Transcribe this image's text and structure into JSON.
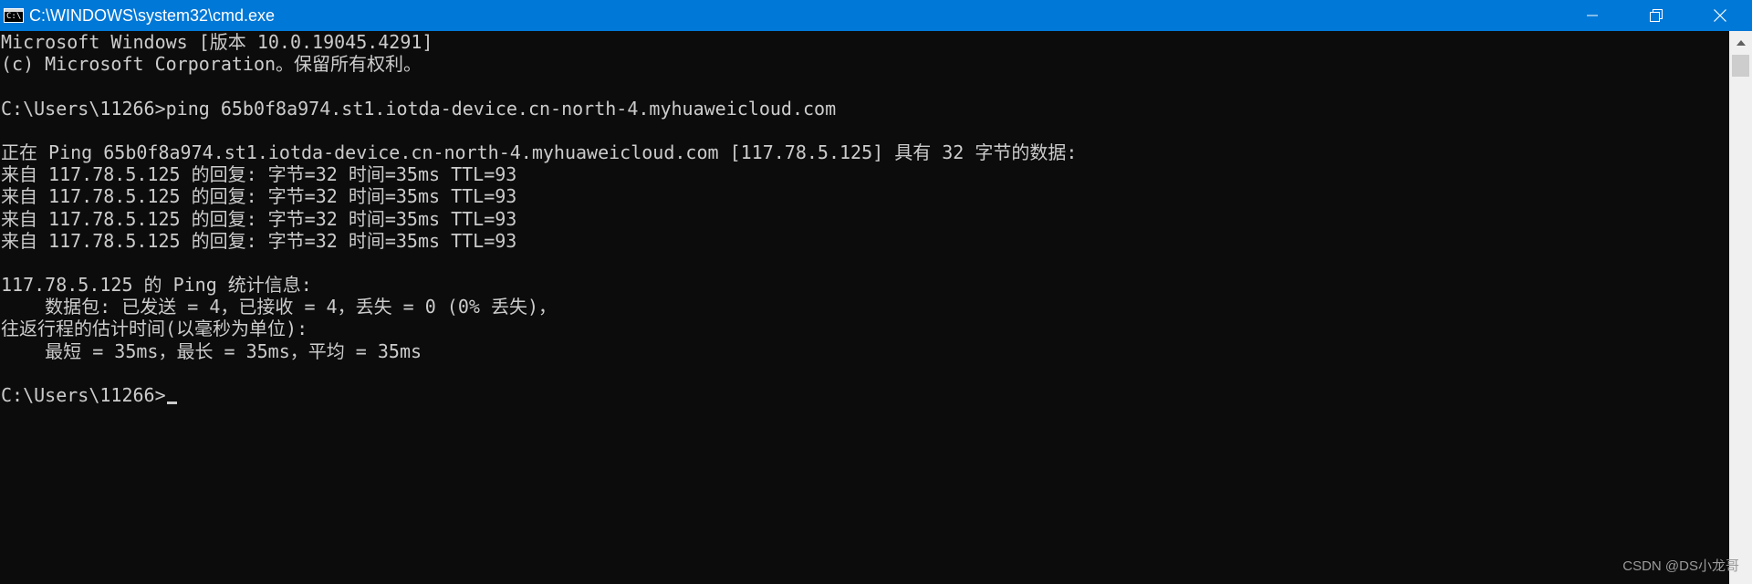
{
  "window": {
    "title": "C:\\WINDOWS\\system32\\cmd.exe",
    "app_icon_text": "C:\\",
    "titlebar_color": "#0078d7",
    "controls": [
      "minimize-icon",
      "restore-icon",
      "close-icon"
    ]
  },
  "console": {
    "background": "#0c0c0c",
    "foreground": "#cccccc",
    "lines": [
      "Microsoft Windows [版本 10.0.19045.4291]",
      "(c) Microsoft Corporation。保留所有权利。",
      "",
      "C:\\Users\\11266>ping 65b0f8a974.st1.iotda-device.cn-north-4.myhuaweicloud.com",
      "",
      "正在 Ping 65b0f8a974.st1.iotda-device.cn-north-4.myhuaweicloud.com [117.78.5.125] 具有 32 字节的数据:",
      "来自 117.78.5.125 的回复: 字节=32 时间=35ms TTL=93",
      "来自 117.78.5.125 的回复: 字节=32 时间=35ms TTL=93",
      "来自 117.78.5.125 的回复: 字节=32 时间=35ms TTL=93",
      "来自 117.78.5.125 的回复: 字节=32 时间=35ms TTL=93",
      "",
      "117.78.5.125 的 Ping 统计信息:",
      "    数据包: 已发送 = 4，已接收 = 4，丢失 = 0 (0% 丢失)，",
      "往返行程的估计时间(以毫秒为单位):",
      "    最短 = 35ms，最长 = 35ms，平均 = 35ms",
      ""
    ],
    "prompt": "C:\\Users\\11266>"
  },
  "watermark": "CSDN @DS小龙哥"
}
